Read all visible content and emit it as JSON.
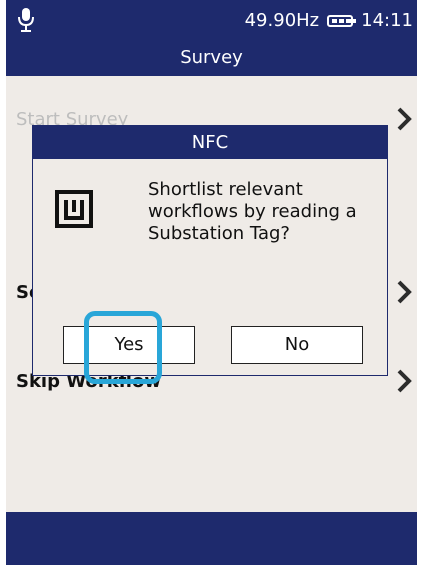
{
  "status_bar": {
    "frequency": "49.90Hz",
    "time": "14:11",
    "mic_icon": "microphone-icon",
    "battery_icon": "battery-icon"
  },
  "header": {
    "title": "Survey"
  },
  "menu": {
    "items": [
      {
        "label": "Start Survey",
        "state": "disabled",
        "icon": "chevron-right-icon"
      },
      {
        "label": "Se",
        "icon": "chevron-right-icon"
      },
      {
        "label": "Skip Workflow",
        "icon": "chevron-right-icon"
      }
    ]
  },
  "dialog": {
    "title": "NFC",
    "message": "Shortlist relevant workflows by reading a Substation Tag?",
    "icon": "nfc-tag-icon",
    "yes_label": "Yes",
    "no_label": "No",
    "highlighted_button": "Yes"
  },
  "colors": {
    "bar": "#1e2a6d",
    "background": "#efebe7",
    "highlight": "#29a6d8"
  }
}
